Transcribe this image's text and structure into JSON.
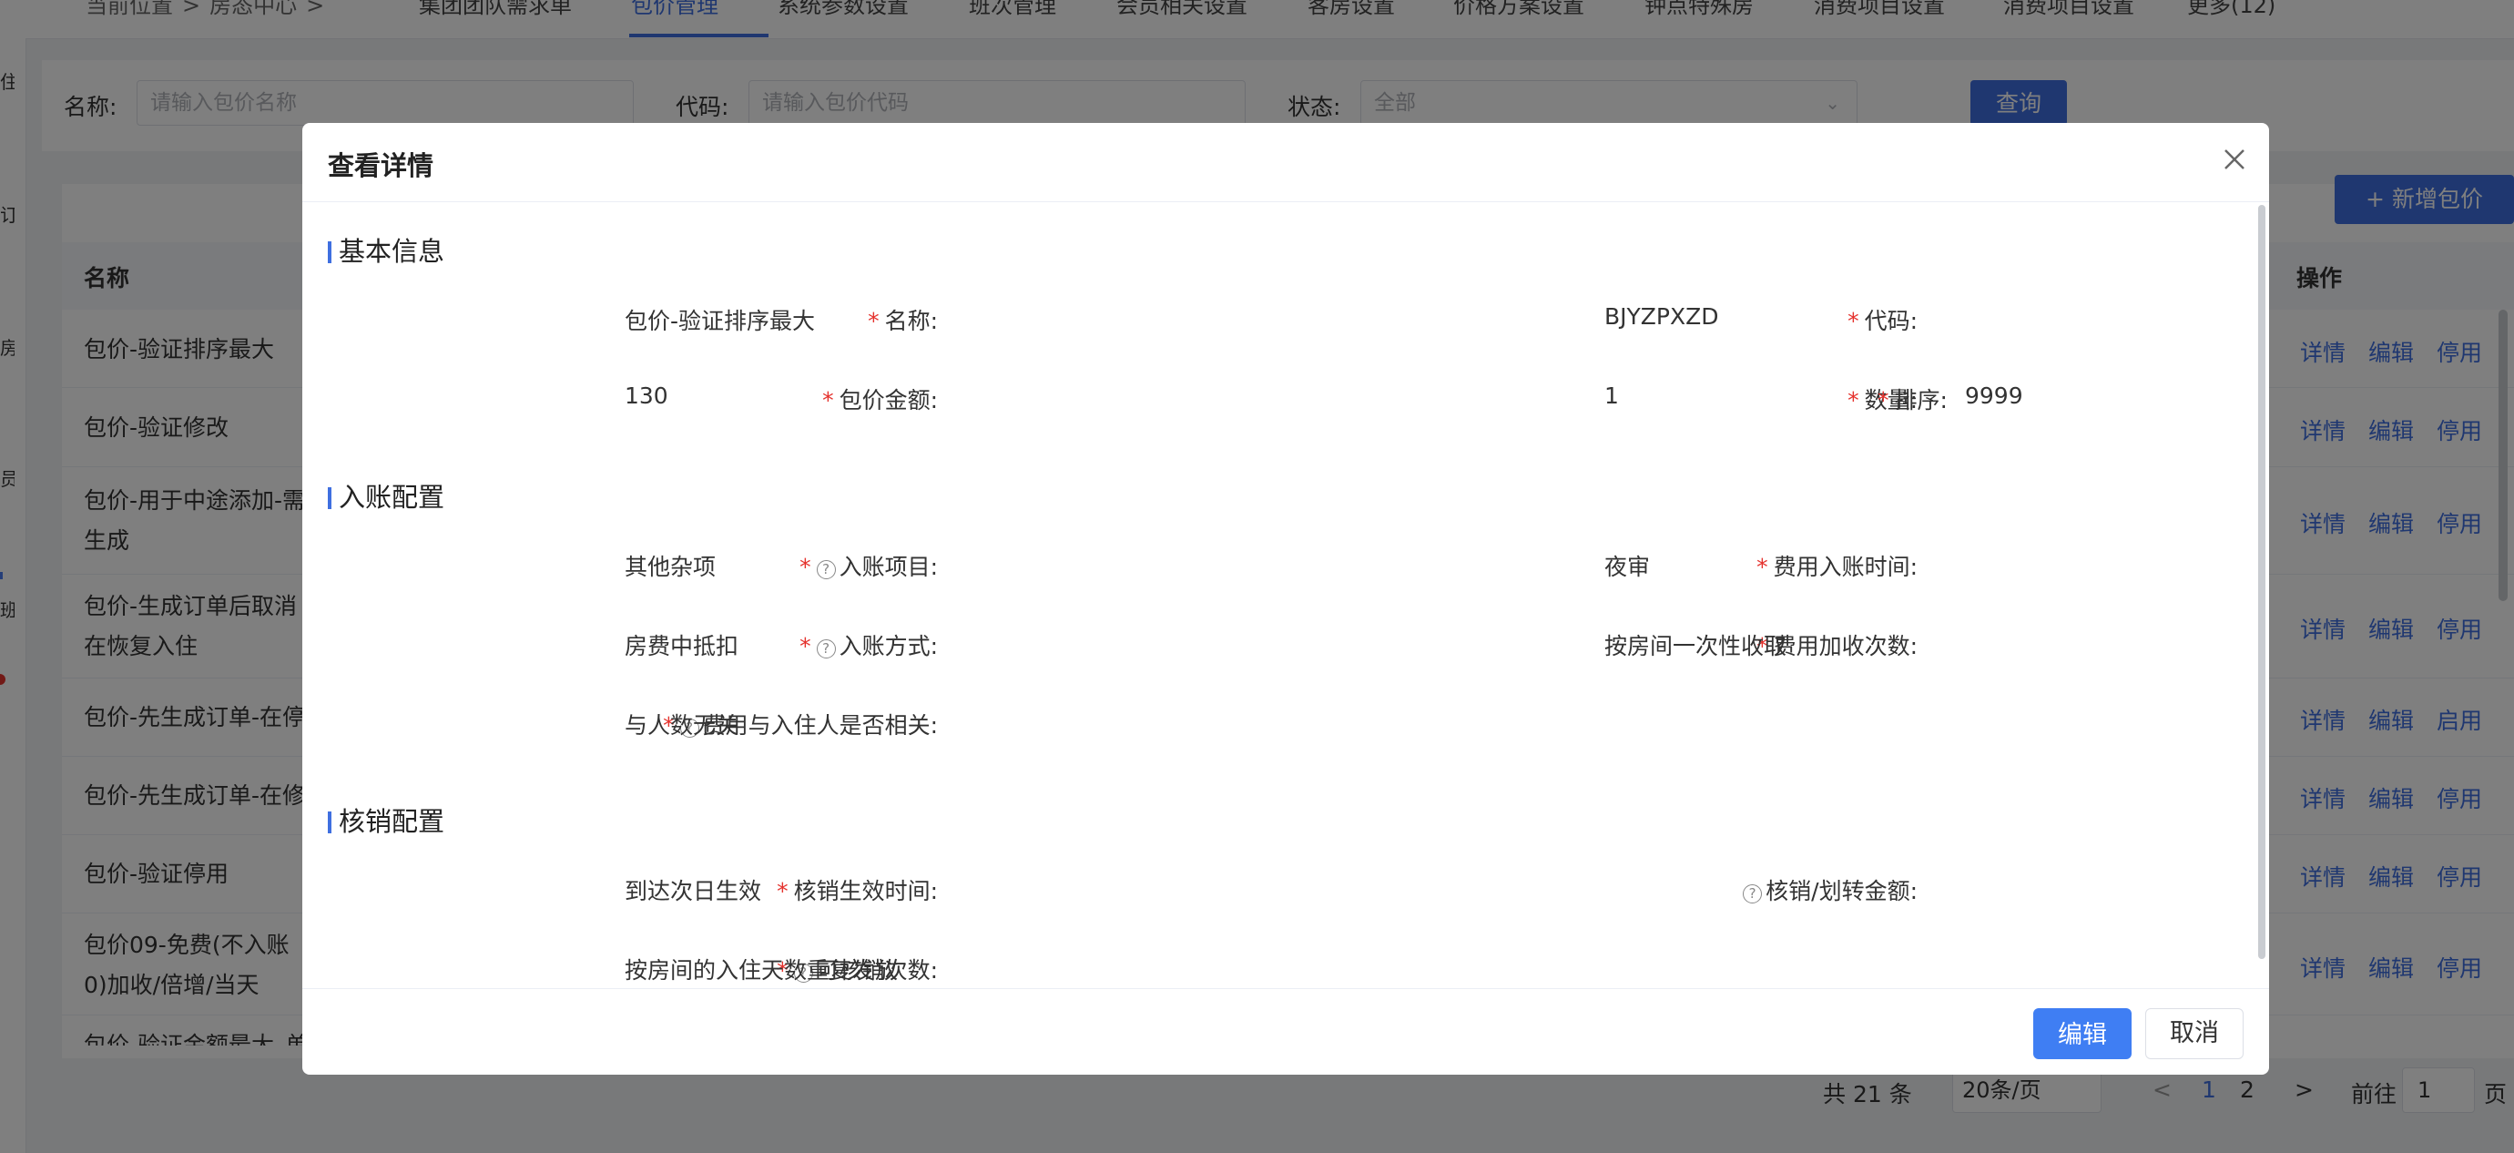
{
  "rail": {
    "items": [
      "住",
      "订",
      "房",
      "员",
      "班"
    ]
  },
  "breadcrumb": {
    "label": "当前位置",
    "sep": ">",
    "current": "房态中心",
    "sep2": ">"
  },
  "tabs": [
    "集团团队需求单",
    "包价管理",
    "系统参数设置",
    "班次管理",
    "会员相关设置",
    "客房设置",
    "价格方案设置",
    "钟点特殊房",
    "消费项目设置",
    "消费项目设置",
    "更多(12)"
  ],
  "filters": {
    "name_label": "名称:",
    "name_placeholder": "请输入包价名称",
    "code_label": "代码:",
    "code_placeholder": "请输入包价代码",
    "status_label": "状态:",
    "status_value": "全部",
    "query_button": "查询"
  },
  "add_button": "+ 新增包价",
  "table": {
    "col_name": "名称",
    "col_ops": "操作",
    "rows": [
      {
        "name": "包价-验证排序最大",
        "ops": [
          "详情",
          "编辑",
          "停用"
        ]
      },
      {
        "name": "包价-验证修改",
        "ops": [
          "详情",
          "编辑",
          "停用"
        ]
      },
      {
        "name": "包价-用于中途添加-需生成",
        "ops": [
          "详情",
          "编辑",
          "停用"
        ]
      },
      {
        "name": "包价-生成订单后取消在恢复入住",
        "ops": [
          "详情",
          "编辑",
          "停用"
        ]
      },
      {
        "name": "包价-先生成订单-在停",
        "ops": [
          "详情",
          "编辑",
          "启用"
        ]
      },
      {
        "name": "包价-先生成订单-在修",
        "ops": [
          "详情",
          "编辑",
          "停用"
        ]
      },
      {
        "name": "包价-验证停用",
        "ops": [
          "详情",
          "编辑",
          "停用"
        ]
      },
      {
        "name": "包价09-免费(不入账0)加收/倍增/当天",
        "ops": [
          "详情",
          "编辑",
          "停用"
        ]
      },
      {
        "name": "包价-验证金额最大_单",
        "ops": []
      }
    ]
  },
  "pagination": {
    "total": "共 21 条",
    "page_size": "20条/页",
    "prev": "<",
    "pages": [
      "1",
      "2"
    ],
    "next": ">",
    "goto_label": "前往",
    "goto_value": "1",
    "page_unit": "页"
  },
  "modal": {
    "title": "查看详情",
    "sections": {
      "basic": "基本信息",
      "posting": "入账配置",
      "writeoff": "核销配置"
    },
    "fields": {
      "name": {
        "label": "名称:",
        "value": "包价-验证排序最大"
      },
      "code": {
        "label": "代码:",
        "value": "BJYZPXZD"
      },
      "amount": {
        "label": "包价金额:",
        "value": "130"
      },
      "qty": {
        "label": "数量:",
        "value": "1"
      },
      "sort": {
        "label": "排序:",
        "value": "9999"
      },
      "post_item": {
        "label": "入账项目:",
        "value": "其他杂项"
      },
      "post_time": {
        "label": "费用入账时间:",
        "value": "夜审"
      },
      "post_method": {
        "label": "入账方式:",
        "value": "房费中抵扣"
      },
      "post_count": {
        "label": "费用加收次数:",
        "value": "按房间一次性收取"
      },
      "guest_related": {
        "label": "费用与入住人是否相关:",
        "value": "与人数无关"
      },
      "effect_time": {
        "label": "核销生效时间:",
        "value": "到达次日生效"
      },
      "transfer_amount": {
        "label": "核销/划转金额:",
        "value": ""
      },
      "writeoff_count": {
        "label": "可核销次数:",
        "value": "按房间的入住天数重复发放"
      }
    },
    "required_mark": "*",
    "help_mark": "?",
    "edit_button": "编辑",
    "cancel_button": "取消"
  }
}
